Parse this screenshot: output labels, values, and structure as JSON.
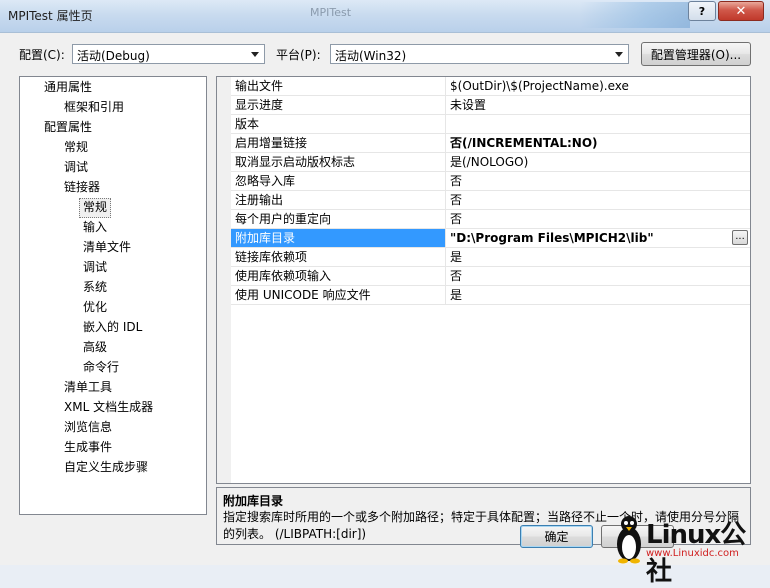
{
  "window": {
    "title": "MPITest 属性页",
    "ghost_tab_label": "MPITest",
    "help_label": "?",
    "close_label": "✕"
  },
  "config": {
    "config_label": "配置(C):",
    "config_value": "活动(Debug)",
    "platform_label": "平台(P):",
    "platform_value": "活动(Win32)",
    "manager_button": "配置管理器(O)..."
  },
  "tree": {
    "items": [
      {
        "label": "通用属性"
      },
      {
        "label": "框架和引用"
      },
      {
        "label": "配置属性"
      },
      {
        "label": "常规"
      },
      {
        "label": "调试"
      },
      {
        "label": "链接器"
      },
      {
        "label": "常规"
      },
      {
        "label": "输入"
      },
      {
        "label": "清单文件"
      },
      {
        "label": "调试"
      },
      {
        "label": "系统"
      },
      {
        "label": "优化"
      },
      {
        "label": "嵌入的 IDL"
      },
      {
        "label": "高级"
      },
      {
        "label": "命令行"
      },
      {
        "label": "清单工具"
      },
      {
        "label": "XML 文档生成器"
      },
      {
        "label": "浏览信息"
      },
      {
        "label": "生成事件"
      },
      {
        "label": "自定义生成步骤"
      }
    ]
  },
  "grid": {
    "rows": [
      {
        "name": "输出文件",
        "value": "$(OutDir)\\$(ProjectName).exe"
      },
      {
        "name": "显示进度",
        "value": "未设置"
      },
      {
        "name": "版本",
        "value": ""
      },
      {
        "name": "启用增量链接",
        "value": "否(/INCREMENTAL:NO)"
      },
      {
        "name": "取消显示启动版权标志",
        "value": "是(/NOLOGO)"
      },
      {
        "name": "忽略导入库",
        "value": "否"
      },
      {
        "name": "注册输出",
        "value": "否"
      },
      {
        "name": "每个用户的重定向",
        "value": "否"
      },
      {
        "name": "附加库目录",
        "value": "\"D:\\Program Files\\MPICH2\\lib\""
      },
      {
        "name": "链接库依赖项",
        "value": "是"
      },
      {
        "name": "使用库依赖项输入",
        "value": "否"
      },
      {
        "name": "使用 UNICODE 响应文件",
        "value": "是"
      }
    ],
    "ellipsis_label": "...",
    "selected_color": "#3399ff"
  },
  "description": {
    "title": "附加库目录",
    "text": "指定搜索库时所用的一个或多个附加路径；特定于具体配置；当路径不止一个时，请使用分号分隔的列表。     (/LIBPATH:[dir])"
  },
  "footer": {
    "ok_button": "确定"
  },
  "watermark": {
    "brand": "Linux公社",
    "url": "www.Linuxidc.com"
  }
}
